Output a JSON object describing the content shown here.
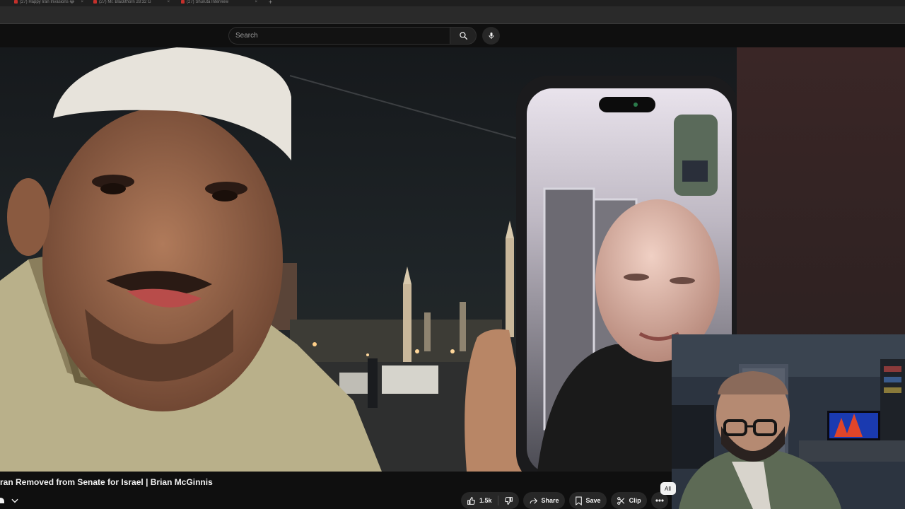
{
  "browser": {
    "tabs": [
      {
        "label": "(27) Happy Iran Invasions 😂"
      },
      {
        "label": "(27) Mr. Blackthorn 28:32 G"
      },
      {
        "label": "(27) Shuruta Interview"
      }
    ],
    "new_tab": "+"
  },
  "search": {
    "placeholder": "Search"
  },
  "video": {
    "title": "ran Removed from Senate for Israel | Brian McGinnis"
  },
  "actions": {
    "like_count": "1.5k",
    "share_label": "Share",
    "save_label": "Save",
    "clip_label": "Clip"
  },
  "chip": {
    "label": "All"
  },
  "colors": {
    "background": "#0f0f0f",
    "pill": "#272727",
    "text": "#f1f1f1"
  }
}
